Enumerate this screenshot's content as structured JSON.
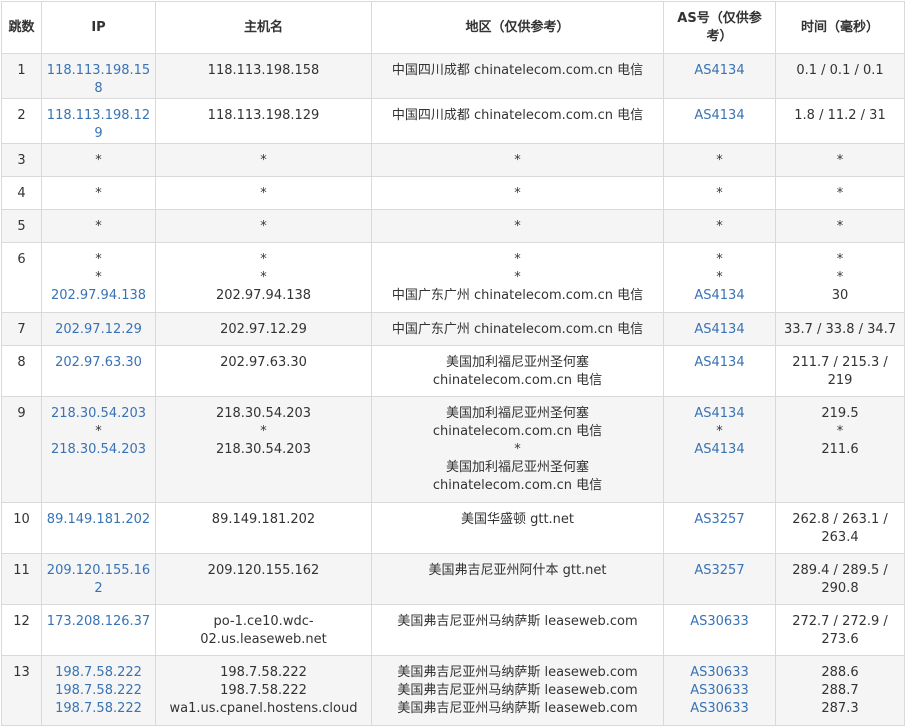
{
  "headers": {
    "hop": "跳数",
    "ip": "IP",
    "host": "主机名",
    "region": "地区（仅供参考）",
    "as": "AS号（仅供参考）",
    "time": "时间（毫秒）"
  },
  "rows": [
    {
      "hop": "1",
      "ip": [
        "118.113.198.158"
      ],
      "host": [
        "118.113.198.158"
      ],
      "region": [
        "中国四川成都 chinatelecom.com.cn 电信"
      ],
      "as": [
        "AS4134"
      ],
      "time": [
        "0.1 / 0.1 / 0.1"
      ]
    },
    {
      "hop": "2",
      "ip": [
        "118.113.198.129"
      ],
      "host": [
        "118.113.198.129"
      ],
      "region": [
        "中国四川成都 chinatelecom.com.cn 电信"
      ],
      "as": [
        "AS4134"
      ],
      "time": [
        "1.8 / 11.2 / 31"
      ]
    },
    {
      "hop": "3",
      "ip": [
        "*"
      ],
      "host": [
        "*"
      ],
      "region": [
        "*"
      ],
      "as": [
        "*"
      ],
      "time": [
        "*"
      ]
    },
    {
      "hop": "4",
      "ip": [
        "*"
      ],
      "host": [
        "*"
      ],
      "region": [
        "*"
      ],
      "as": [
        "*"
      ],
      "time": [
        "*"
      ]
    },
    {
      "hop": "5",
      "ip": [
        "*"
      ],
      "host": [
        "*"
      ],
      "region": [
        "*"
      ],
      "as": [
        "*"
      ],
      "time": [
        "*"
      ]
    },
    {
      "hop": "6",
      "ip": [
        "*",
        "*",
        "202.97.94.138"
      ],
      "host": [
        "*",
        "*",
        "202.97.94.138"
      ],
      "region": [
        "*",
        "*",
        "中国广东广州 chinatelecom.com.cn 电信"
      ],
      "as": [
        "*",
        "*",
        "AS4134"
      ],
      "time": [
        "*",
        "*",
        "30"
      ]
    },
    {
      "hop": "7",
      "ip": [
        "202.97.12.29"
      ],
      "host": [
        "202.97.12.29"
      ],
      "region": [
        "中国广东广州 chinatelecom.com.cn 电信"
      ],
      "as": [
        "AS4134"
      ],
      "time": [
        "33.7 / 33.8 / 34.7"
      ]
    },
    {
      "hop": "8",
      "ip": [
        "202.97.63.30"
      ],
      "host": [
        "202.97.63.30"
      ],
      "region": [
        "美国加利福尼亚州圣何塞 chinatelecom.com.cn 电信"
      ],
      "as": [
        "AS4134"
      ],
      "time": [
        "211.7 / 215.3 / 219"
      ]
    },
    {
      "hop": "9",
      "ip": [
        "218.30.54.203",
        "*",
        "218.30.54.203"
      ],
      "host": [
        "218.30.54.203",
        "*",
        "218.30.54.203"
      ],
      "region": [
        "美国加利福尼亚州圣何塞 chinatelecom.com.cn 电信",
        "*",
        "美国加利福尼亚州圣何塞 chinatelecom.com.cn 电信"
      ],
      "as": [
        "AS4134",
        "*",
        "AS4134"
      ],
      "time": [
        "219.5",
        "*",
        "211.6"
      ]
    },
    {
      "hop": "10",
      "ip": [
        "89.149.181.202"
      ],
      "host": [
        "89.149.181.202"
      ],
      "region": [
        "美国华盛顿 gtt.net"
      ],
      "as": [
        "AS3257"
      ],
      "time": [
        "262.8 / 263.1 / 263.4"
      ]
    },
    {
      "hop": "11",
      "ip": [
        "209.120.155.162"
      ],
      "host": [
        "209.120.155.162"
      ],
      "region": [
        "美国弗吉尼亚州阿什本 gtt.net"
      ],
      "as": [
        "AS3257"
      ],
      "time": [
        "289.4 / 289.5 / 290.8"
      ]
    },
    {
      "hop": "12",
      "ip": [
        "173.208.126.37"
      ],
      "host": [
        "po-1.ce10.wdc-02.us.leaseweb.net"
      ],
      "region": [
        "美国弗吉尼亚州马纳萨斯 leaseweb.com"
      ],
      "as": [
        "AS30633"
      ],
      "time": [
        "272.7 / 272.9 / 273.6"
      ]
    },
    {
      "hop": "13",
      "ip": [
        "198.7.58.222",
        "198.7.58.222",
        "198.7.58.222"
      ],
      "host": [
        "198.7.58.222",
        "198.7.58.222",
        "wa1.us.cpanel.hostens.cloud"
      ],
      "region": [
        "美国弗吉尼亚州马纳萨斯 leaseweb.com",
        "美国弗吉尼亚州马纳萨斯 leaseweb.com",
        "美国弗吉尼亚州马纳萨斯 leaseweb.com"
      ],
      "as": [
        "AS30633",
        "AS30633",
        "AS30633"
      ],
      "time": [
        "288.6",
        "288.7",
        "287.3"
      ]
    }
  ]
}
